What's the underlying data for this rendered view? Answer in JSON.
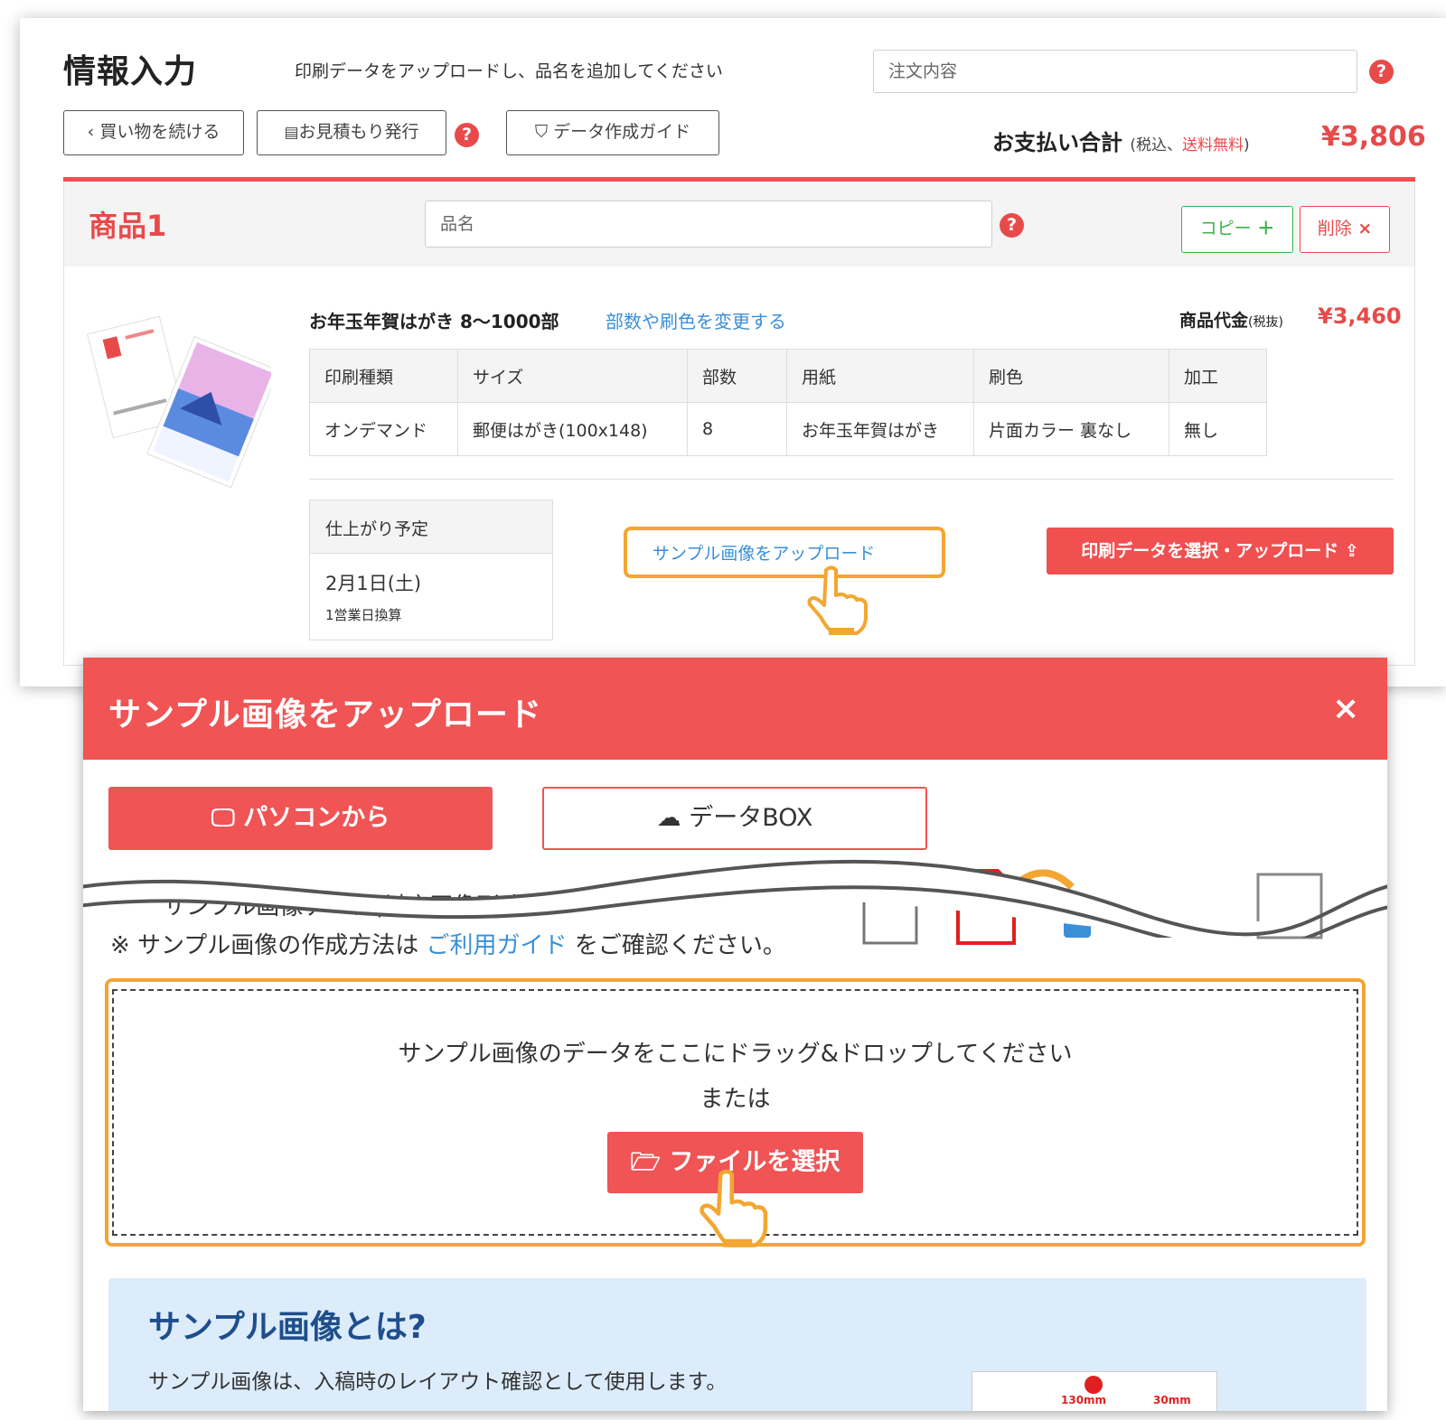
{
  "header": {
    "title": "情報入力",
    "subtitle": "印刷データをアップロードし、品名を追加してください",
    "order_placeholder": "注文内容",
    "help": "?"
  },
  "toolbar": {
    "continue_label": "買い物を続ける",
    "quote_label": "お見積もり発行",
    "guide_label": "データ作成ガイド",
    "pay_label": "お支払い合計",
    "tax_prefix": "(税込、",
    "shipping_free": "送料無料",
    "tax_suffix": ")",
    "total": "¥3,806"
  },
  "item": {
    "number_label": "商品1",
    "name_placeholder": "品名",
    "copy_label": "コピー",
    "delete_label": "削除",
    "product_name": "お年玉年賀はがき 8〜1000部",
    "change_link": "部数や刷色を変更する",
    "price_label": "商品代金",
    "price_tax": "(税抜)",
    "price": "¥3,460",
    "spec_headers": [
      "印刷種類",
      "サイズ",
      "部数",
      "用紙",
      "刷色",
      "加工"
    ],
    "spec_values": [
      "オンデマンド",
      "郵便はがき(100x148)",
      "8",
      "お年玉年賀はがき",
      "片面カラー 裏なし",
      "無し"
    ],
    "finish_label": "仕上がり予定",
    "finish_date": "2月1日(土)",
    "finish_note": "1営業日換算",
    "sample_upload_link": "サンプル画像をアップロード",
    "print_upload_label": "印刷データを選択・アップロード"
  },
  "dialog": {
    "title": "サンプル画像をアップロード",
    "close": "×",
    "tab_pc": "パソコンから",
    "tab_box": "データBOX",
    "format_line": "サンプル画像データ(対応画像形式：",
    "note_prefix": "※ サンプル画像の作成方法は",
    "note_link": "ご利用ガイド",
    "note_suffix": "をご確認ください。",
    "drop_text": "サンプル画像のデータをここにドラッグ&ドロップしてください",
    "drop_or": "または",
    "file_button": "ファイルを選択",
    "info_title": "サンプル画像とは?",
    "info_text": "サンプル画像は、入稿時のレイアウト確認として使用します。",
    "info_img_label_1": "130mm",
    "info_img_label_2": "30mm"
  },
  "colors": {
    "accent": "#f05454",
    "link": "#3a8fd8",
    "highlight": "#f3a632",
    "success": "#3bb24a"
  }
}
